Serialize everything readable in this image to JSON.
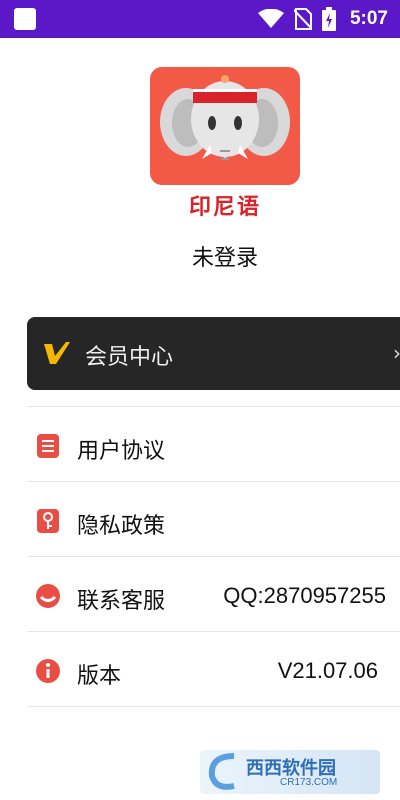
{
  "status_bar": {
    "time": "5:07",
    "icons": [
      "wifi-icon",
      "no-sim-icon",
      "battery-charging-icon"
    ],
    "background": "#5b18c9"
  },
  "profile": {
    "app_name": "印尼语",
    "login_status": "未登录",
    "logo_bg": "#f25a47"
  },
  "vip": {
    "label": "会员中心",
    "icon": "vip-v-icon",
    "accent": "#f5b800"
  },
  "menu": {
    "items": [
      {
        "label": "用户协议",
        "value": "",
        "icon": "document-icon"
      },
      {
        "label": "隐私政策",
        "value": "",
        "icon": "privacy-key-icon"
      },
      {
        "label": "联系客服",
        "value": "QQ:2870957255",
        "icon": "customer-service-icon"
      },
      {
        "label": "版本",
        "value": "V21.07.06",
        "icon": "info-icon"
      }
    ],
    "icon_color": "#e94e45"
  },
  "watermark": {
    "text": "西西软件园",
    "sub": "CR173.COM"
  }
}
